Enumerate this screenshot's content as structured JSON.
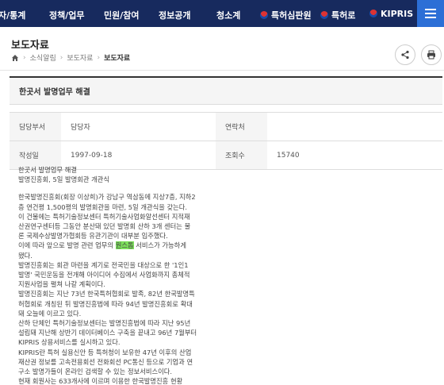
{
  "nav": {
    "items": [
      "자/통계",
      "정책/업무",
      "민원/참여",
      "정보공개",
      "청소계",
      "특허심판원",
      "특허로",
      "KIPRIS"
    ]
  },
  "header": {
    "title": "보도자료",
    "breadcrumb": [
      "소식알림",
      "보도자료",
      "보도자료"
    ]
  },
  "post": {
    "title": "한곳서 발명업무 해결",
    "dept_label": "담당부서",
    "dept_value": "담당자",
    "contact_label": "연락처",
    "date_label": "작성일",
    "date_value": "1997-09-18",
    "views_label": "조회수",
    "views_value": "15740"
  },
  "content": {
    "intro1": "한곳서 발명업무 해결",
    "intro2": "발명진흥회, 5일 발명회관 개관식",
    "lines": [
      "한국발명진흥회(회장 이상희)가 강남구 역삼동에 지상7층, 지하2",
      "층 연건평 1,500평의 발명회관을 마련, 5일 개관식을 갖는다.",
      "이 건물에는 특허기술정보센터 특허기술사업화알선센터 지적재",
      "산권연구센터등 그동안 분산돼 있던 발명회 산하 3개 센터는 물",
      "론 국제수상발명가협회등 유관기관이 대부분 입주했다."
    ],
    "line6_pre": "이에 따라 앞으로 발명 관련 업무의 ",
    "line6_hl": "원스톱",
    "line6_post": " 서비스가 가능하게",
    "lines2": [
      "됐다.",
      "발명진흥회는 회관 마련을 계기로 전국민을 대상으로 한 '1인1",
      "발명' 국민운동을 전개해 아이디어 수집에서 사업화까지 총체적",
      "지원사업을 펼쳐 나갈 계획이다.",
      "발명진흥회는 지난 73년 한국특허협회로 발족, 82년 한국발명특",
      "허협회로 개칭된 뒤 발명진흥법에 따라 94년 발명진흥회로 확대",
      "돼 오늘에 이르고 있다.",
      "산하 단체인 특허기술정보센터는 발명진흥법에 따라 지난 95년",
      "설립돼 지난해 상반기 데이터베이스 구축을 끝내고 96년 7월부터",
      "KIPRIS 상용서비스를 실시하고 있다.",
      "KIPRIS란 특허 실용신안 등 특허청이 보유한 47년 이후의 산업",
      "재산권 정보를 고속전용회선 전화회선 PC통신 등으로 기업과 연",
      "구소 발명가들이 온라인 검색할 수 있는 정보서비스이다.",
      "현재 회원사는 633개사에 이르며 이용한 한국발명진흥 현황"
    ]
  }
}
